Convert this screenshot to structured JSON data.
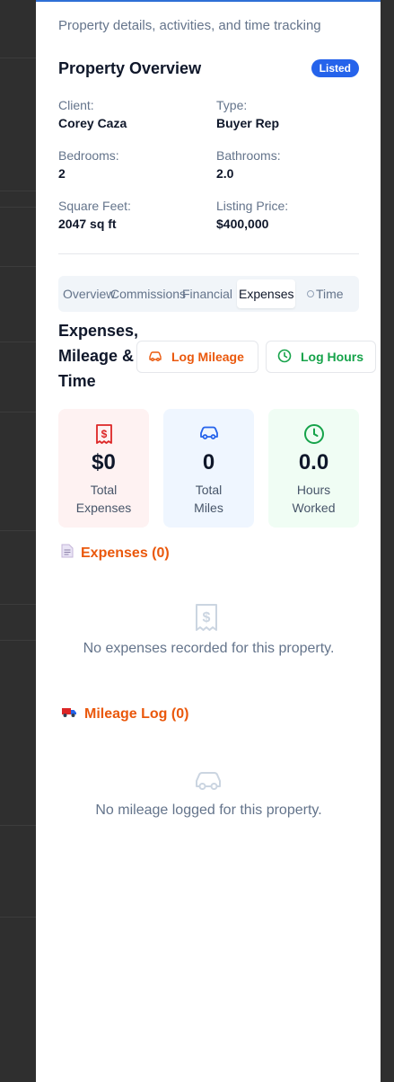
{
  "panel": {
    "subtitle": "Property details, activities, and time tracking"
  },
  "overview": {
    "title": "Property Overview",
    "status_badge": "Listed",
    "fields": {
      "client_label": "Client:",
      "client_value": "Corey Caza",
      "type_label": "Type:",
      "type_value": "Buyer Rep",
      "bedrooms_label": "Bedrooms:",
      "bedrooms_value": "2",
      "bathrooms_label": "Bathrooms:",
      "bathrooms_value": "2.0",
      "sqft_label": "Square Feet:",
      "sqft_value": "2047 sq ft",
      "price_label": "Listing Price:",
      "price_value": "$400,000"
    }
  },
  "tabs": [
    {
      "label": "Overview"
    },
    {
      "label": "Commissions"
    },
    {
      "label": "Financial"
    },
    {
      "label": "Expenses"
    },
    {
      "label": "Time"
    }
  ],
  "active_tab": "Expenses",
  "expenses_section": {
    "heading_line1": "Expenses,",
    "heading_line2": "Mileage &",
    "heading_line3": "Time",
    "log_mileage_label": "Log Mileage",
    "log_hours_label": "Log Hours"
  },
  "stats": {
    "total_expenses_value": "$0",
    "total_expenses_line1": "Total",
    "total_expenses_line2": "Expenses",
    "total_miles_value": "0",
    "total_miles_line1": "Total",
    "total_miles_line2": "Miles",
    "hours_value": "0.0",
    "hours_line1": "Hours",
    "hours_line2": "Worked"
  },
  "expenses_list": {
    "heading": "Expenses (0)",
    "empty_text": "No expenses recorded for this property."
  },
  "mileage_list": {
    "heading": "Mileage Log (0)",
    "empty_text": "No mileage logged for this property."
  },
  "colors": {
    "badge": "#2563eb",
    "orange_accent": "#ea580c",
    "green_accent": "#16a34a",
    "blue_icon": "#2563eb",
    "red_icon": "#dc2626"
  },
  "icons": {
    "expenses_card": "receipt-dollar-icon",
    "miles_card": "car-icon",
    "hours_card": "clock-icon",
    "log_mileage": "car-icon",
    "log_hours": "clock-icon",
    "expenses_heading": "document-icon",
    "mileage_heading": "truck-icon"
  }
}
